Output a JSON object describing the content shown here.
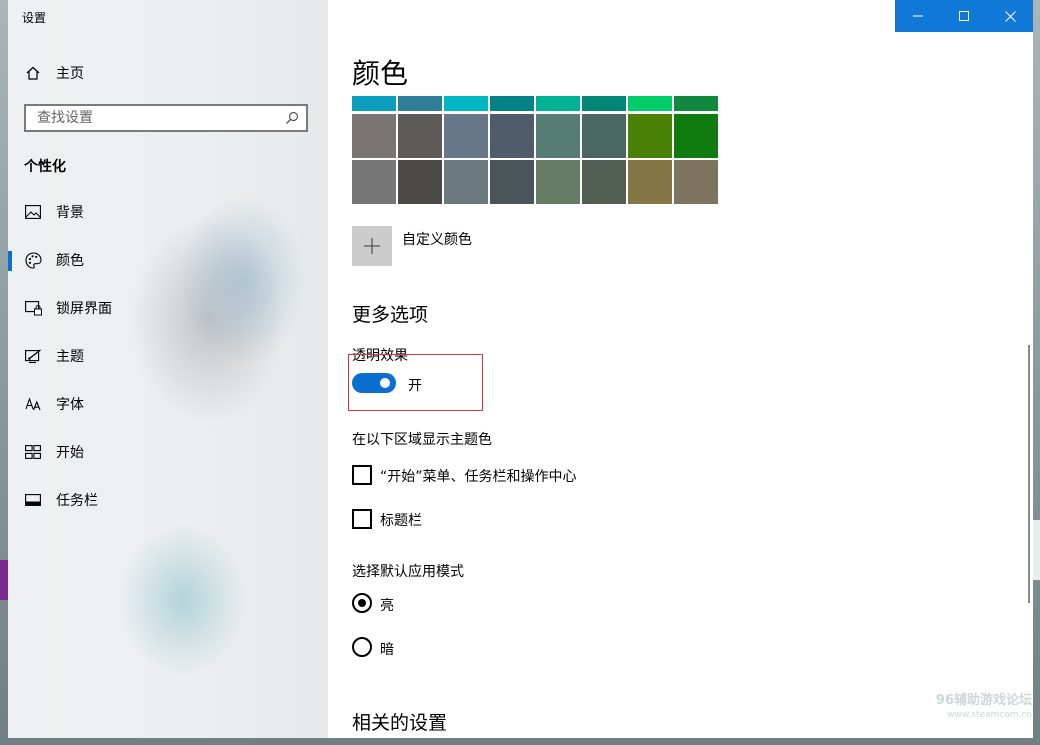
{
  "window": {
    "title": "设置"
  },
  "sidebar": {
    "home_label": "主页",
    "search_placeholder": "查找设置",
    "section_title": "个性化",
    "items": [
      {
        "label": "背景",
        "icon": "image-icon",
        "active": false
      },
      {
        "label": "颜色",
        "icon": "palette-icon",
        "active": true
      },
      {
        "label": "锁屏界面",
        "icon": "lock-screen-icon",
        "active": false
      },
      {
        "label": "主题",
        "icon": "theme-brush-icon",
        "active": false
      },
      {
        "label": "字体",
        "icon": "font-icon",
        "active": false
      },
      {
        "label": "开始",
        "icon": "start-grid-icon",
        "active": false
      },
      {
        "label": "任务栏",
        "icon": "taskbar-icon",
        "active": false
      }
    ]
  },
  "content": {
    "page_title": "颜色",
    "swatches": {
      "top_row": [
        "#0b9ebd",
        "#2e7e98",
        "#00b7c3",
        "#038387",
        "#00b294",
        "#018574",
        "#00cc6a",
        "#10893e"
      ],
      "row2": [
        "#7a7574",
        "#5d5a58",
        "#68768a",
        "#515c6b",
        "#567c73",
        "#486860",
        "#498205",
        "#107c10"
      ],
      "row3": [
        "#767676",
        "#4c4a48",
        "#69797e",
        "#4a5459",
        "#647c64",
        "#525e54",
        "#847545",
        "#7e735f"
      ]
    },
    "custom_color_label": "自定义颜色",
    "more_options_title": "更多选项",
    "transparency_label": "透明效果",
    "transparency_state": "开",
    "accent_surfaces_title": "在以下区域显示主题色",
    "checkbox_start": "“开始”菜单、任务栏和操作中心",
    "checkbox_titlebar": "标题栏",
    "app_mode_title": "选择默认应用模式",
    "radio_light": "亮",
    "radio_dark": "暗",
    "related_title": "相关的设置"
  },
  "watermark": {
    "line1": "96辅助游戏论坛",
    "line2": "www.steamcom.cn"
  },
  "colors": {
    "accent": "#0b6fd1",
    "titlebar_buttons": "#1078d6",
    "highlight_box": "#e0323b"
  }
}
